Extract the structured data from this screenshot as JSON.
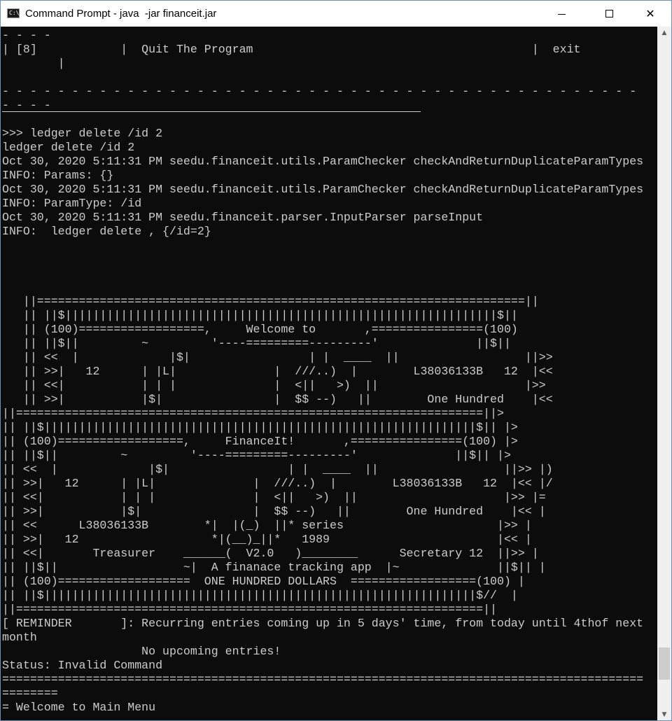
{
  "window": {
    "title": "Command Prompt - java  -jar financeit.jar",
    "icon_name": "command-prompt-icon",
    "minimize_icon": "minimize-icon",
    "maximize_icon": "maximize-icon",
    "close_icon": "close-icon",
    "close_glyph": "✕"
  },
  "console": {
    "lines": [
      "- - - -",
      "| [8]            |  Quit The Program                                        |  exit",
      "        |",
      "",
      "- - - - - - - - - - - - - - - - - - - - - - - - - - - - - - - - - - - - - - - - - - - - - -",
      "- - - -",
      "",
      ">>> ledger delete /id 2",
      "ledger delete /id 2",
      "Oct 30, 2020 5:11:31 PM seedu.financeit.utils.ParamChecker checkAndReturnDuplicateParamTypes",
      "INFO: Params: {}",
      "Oct 30, 2020 5:11:31 PM seedu.financeit.utils.ParamChecker checkAndReturnDuplicateParamTypes",
      "INFO: ParamType: /id",
      "Oct 30, 2020 5:11:31 PM seedu.financeit.parser.InputParser parseInput",
      "INFO:  ledger delete , {/id=2}",
      "",
      "",
      "",
      "",
      "   ||======================================================================||",
      "   || ||$||||||||||||||||||||||||||||||||||||||||||||||||||||||||||||||$||",
      "   || (100)==================,     Welcome to       ,================(100)",
      "   || ||$||         ~         '----=========---------'              ||$||",
      "   || <<  |             |$|                 | |  ____  ||                  ||>>",
      "   || >>|   12      | |L|              |  ///..)  |        L38036133B   12  |<<",
      "   || <<|           | | |              |  <||   >)  ||                     |>>",
      "   || >>|           |$|                |  $$ --)   ||        One Hundred    |<<",
      "||===================================================================||>",
      "|| ||$||||||||||||||||||||||||||||||||||||||||||||||||||||||||||||||$|| |>",
      "|| (100)==================,     FinanceIt!       ,================(100) |>",
      "|| ||$||         ~         '----=========---------'              ||$|| |>",
      "|| <<  |             |$|                 | |  ____  ||                  ||>> |)",
      "|| >>|   12      | |L|              |  ///..)  |        L38036133B   12  |<< |/",
      "|| <<|           | | |              |  <||   >)  ||                     |>> |=",
      "|| >>|           |$|                |  $$ --)   ||        One Hundred    |<< |",
      "|| <<      L38036133B        *|  |(_)  ||* series                      |>> |",
      "|| >>|   12                   *|(__)_||*   1989                        |<< |",
      "|| <<|       Treasurer    ______(  V2.0   )________      Secretary 12  ||>> |",
      "|| ||$||                  ~|  A finanace tracking app  |~              ||$|| |",
      "|| (100)===================  ONE HUNDRED DOLLARS  ==================(100) |",
      "|| ||$||||||||||||||||||||||||||||||||||||||||||||||||||||||||||||||$//  |",
      "||===================================================================||",
      "[ REMINDER       ]: Recurring entries coming up in 5 days' time, from today until 4thof next",
      "month",
      "                    No upcoming entries!",
      "Status: Invalid Command",
      "============================================================================================",
      "========",
      "= Welcome to Main Menu"
    ]
  },
  "scrollbar": {
    "up_glyph": "▲",
    "down_glyph": "▼"
  }
}
